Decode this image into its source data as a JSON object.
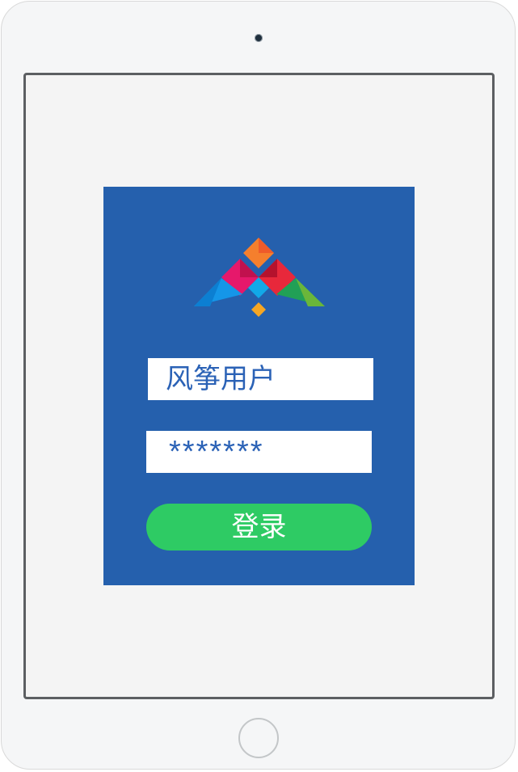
{
  "login": {
    "username_value": "风筝用户",
    "password_value": "*******",
    "submit_label": "登录"
  },
  "colors": {
    "panel_background": "#2560ad",
    "button_background": "#2ecb64",
    "input_text": "#2b62b6"
  },
  "icons": {
    "logo": "kite-logo-icon",
    "camera": "front-camera-icon",
    "home": "home-button-icon"
  }
}
